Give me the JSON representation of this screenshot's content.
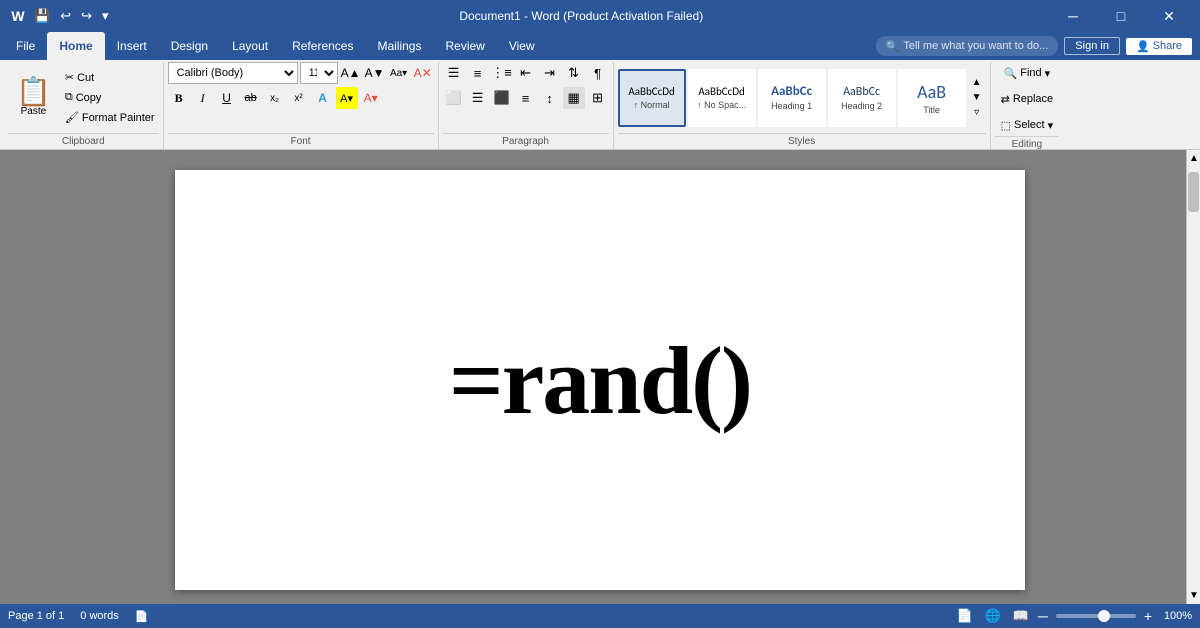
{
  "titlebar": {
    "title": "Document1 - Word (Product Activation Failed)",
    "quickaccess": {
      "save": "💾",
      "undo": "↩",
      "redo": "↪",
      "customize": "▾"
    },
    "controls": {
      "restore": "🗖",
      "minimize": "─",
      "maximize": "□",
      "close": "✕"
    }
  },
  "tabs": [
    "File",
    "Home",
    "Insert",
    "Design",
    "Layout",
    "References",
    "Mailings",
    "Review",
    "View"
  ],
  "active_tab": "Home",
  "search_placeholder": "Tell me what you want to do...",
  "ribbon": {
    "groups": {
      "clipboard": {
        "label": "Clipboard",
        "paste": "Paste",
        "cut": "Cut",
        "copy": "Copy",
        "format_painter": "Format Painter"
      },
      "font": {
        "label": "Font",
        "font_name": "Calibri (Body)",
        "font_size": "11",
        "bold": "B",
        "italic": "I",
        "underline": "U",
        "strikethrough": "ab",
        "subscript": "x₂",
        "superscript": "x²"
      },
      "paragraph": {
        "label": "Paragraph"
      },
      "styles": {
        "label": "Styles",
        "items": [
          {
            "preview": "AaBbCcDd",
            "label": "↑ Normal",
            "active": true
          },
          {
            "preview": "AaBbCcDd",
            "label": "↑ No Spac..."
          },
          {
            "preview": "AaBbCc",
            "label": "Heading 1"
          },
          {
            "preview": "AaBbCc",
            "label": "Heading 2"
          },
          {
            "preview": "AaB",
            "label": "Title"
          }
        ]
      },
      "editing": {
        "label": "Editing",
        "find": "Find",
        "replace": "Replace",
        "select": "Select"
      }
    }
  },
  "document": {
    "content": "=rand()"
  },
  "statusbar": {
    "page": "Page 1 of 1",
    "words": "0 words",
    "zoom": "100%"
  },
  "signin": "Sign in",
  "share": "Share"
}
